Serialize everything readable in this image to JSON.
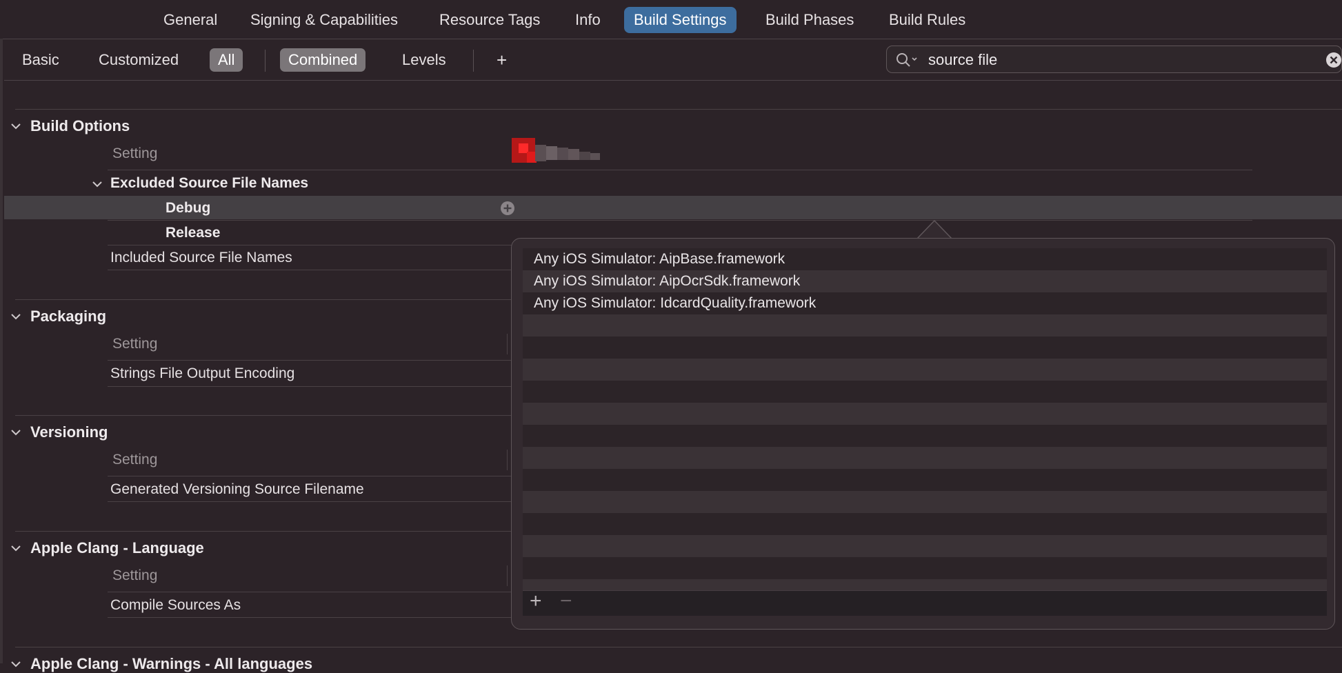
{
  "top_tabs": [
    "General",
    "Signing & Capabilities",
    "Resource Tags",
    "Info",
    "Build Settings",
    "Build Phases",
    "Build Rules"
  ],
  "active_tab": "Build Settings",
  "filters": {
    "basic": "Basic",
    "customized": "Customized",
    "all": "All",
    "combined": "Combined",
    "levels": "Levels",
    "add": "+"
  },
  "search": {
    "value": "source file"
  },
  "sections": {
    "build_options": {
      "title": "Build Options",
      "setting": "Setting",
      "excluded_title": "Excluded Source File Names",
      "debug": "Debug",
      "release": "Release",
      "included": "Included Source File Names"
    },
    "packaging": {
      "title": "Packaging",
      "setting": "Setting",
      "row": "Strings File Output Encoding"
    },
    "versioning": {
      "title": "Versioning",
      "setting": "Setting",
      "row": "Generated Versioning Source Filename"
    },
    "clang_language": {
      "title": "Apple Clang - Language",
      "setting": "Setting",
      "row": "Compile Sources As"
    },
    "clang_warnings": {
      "title": "Apple Clang - Warnings - All languages"
    }
  },
  "popover": {
    "items": [
      "Any iOS Simulator: AipBase.framework",
      "Any iOS Simulator: AipOcrSdk.framework",
      "Any iOS Simulator: IdcardQuality.framework"
    ],
    "empty_rows": 12,
    "add": "+",
    "remove": "−"
  },
  "colors": {
    "accent": "#3d6d9e",
    "background": "#2c2328",
    "selected_row": "#444044",
    "pixelated_value": "#e01b1b"
  },
  "icons": [
    "chevron-down-icon",
    "search-icon",
    "clear-icon",
    "add-circle-icon"
  ]
}
